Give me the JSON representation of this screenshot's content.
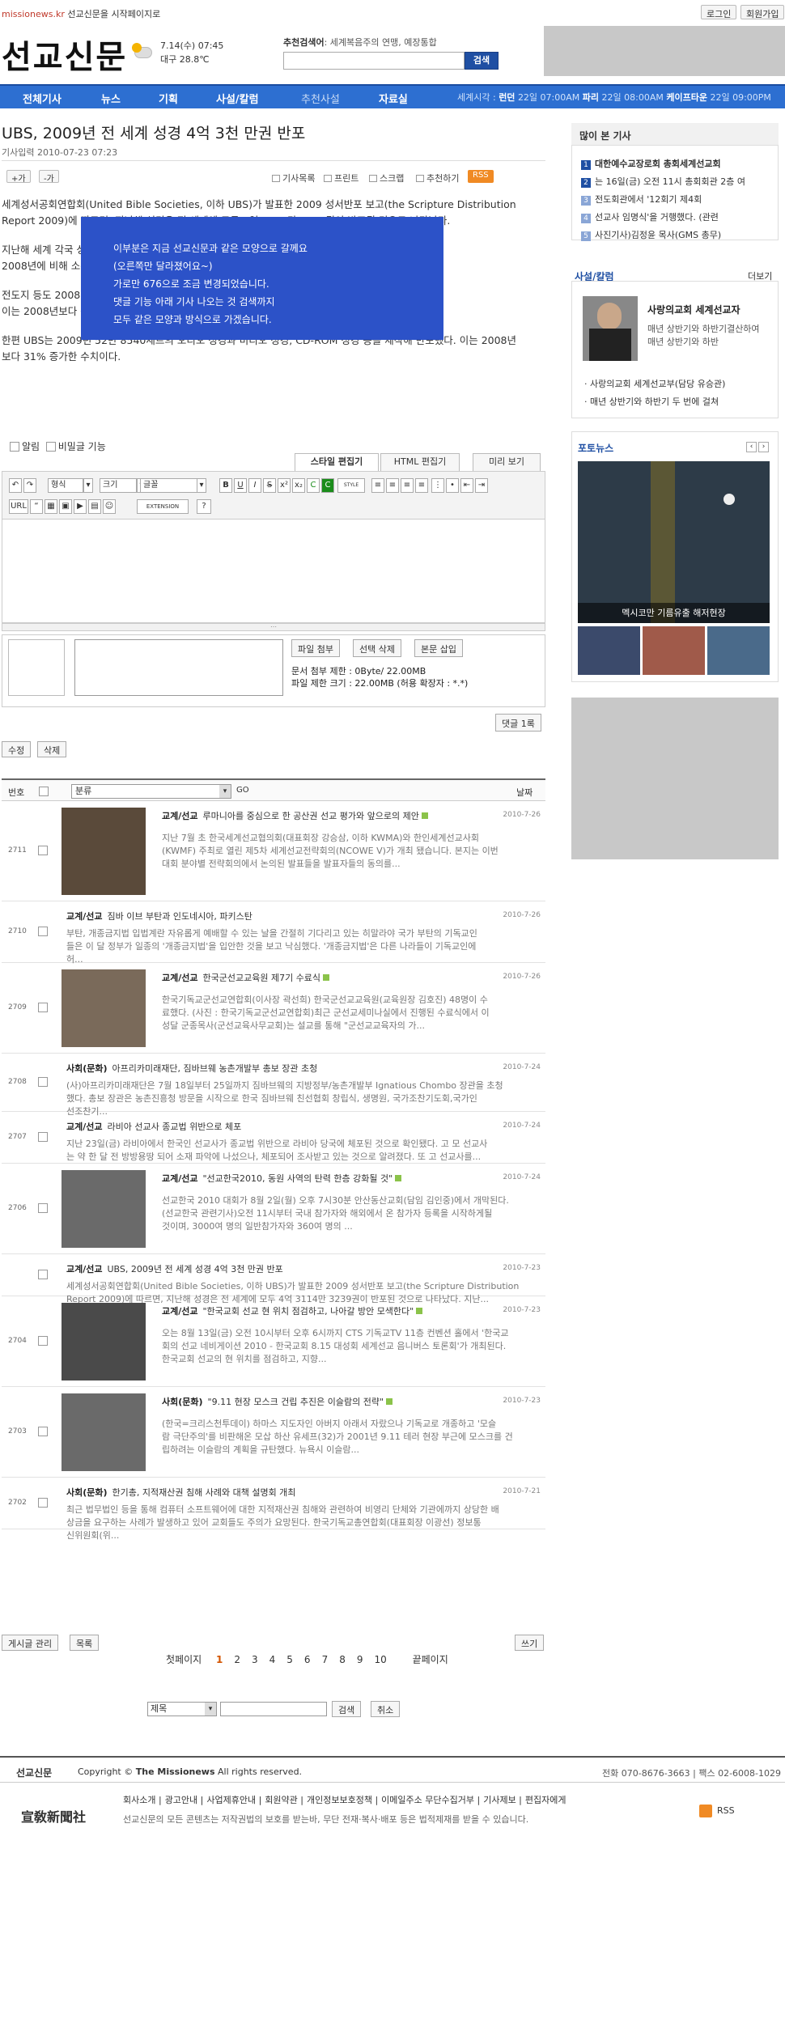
{
  "top": {
    "site": "missionews.kr",
    "set_home": "선교신문을 시작페이지로",
    "login": "로그인",
    "join": "회원가입"
  },
  "header": {
    "logo": "선교신문",
    "weather_date": "7.14(수) 07:45",
    "weather_temp": "대구 28.8℃",
    "rec_label": "추천검색어",
    "rec_terms": ": 세계복음주의 연맹, 예장통합",
    "search_button": "검색"
  },
  "nav": {
    "items": [
      "전체기사",
      "뉴스",
      "기획",
      "사설/칼럼",
      "추천사설",
      "자료실"
    ],
    "worldtime_label": "세계시각 :",
    "cities": [
      {
        "city": "런던",
        "time": "22일 07:00AM"
      },
      {
        "city": "파리",
        "time": "22일 08:00AM"
      },
      {
        "city": "케이프타운",
        "time": "22일 09:00PM"
      }
    ]
  },
  "article": {
    "title": "UBS, 2009년 전 세계 성경 4억 3천 만권 반포",
    "date_label": "기사입력",
    "date": "2010-07-23 07:23",
    "font_plus": "+가",
    "font_minus": "-가",
    "tools": [
      "기사목록",
      "프린트",
      "스크랩",
      "추천하기"
    ],
    "rss": "RSS",
    "paragraphs": [
      "세계성서공회연합회(United Bible Societies, 이하 UBS)가 발표한 2009 성서반포 보고(the Scripture Distribution",
      "Report 2009)에 따르면, 지난해 성경은 전 세계에 모두 4억 3114만 3239권이 반포된 것으로 나타났다.",
      "지난해 세계 각국 성서공회가 반포한 성경 중 신약성경과 구약성경을 포함한 전권 성경 등의 반포 부수는",
      "2008년에 비해 소폭 증가했으며, 특히 아시아 지역의 반포량이 크게 증가한 것으로 나타났다.",
      "전도지 등도 2008년에 비해 늘어났으며, 선택본 성경과 신약성경, 단편성경, 전도지는 6400만 부",
      "이는 2008년보다 증가한 수치로, 특히 전도지의 반포는 1억 부 이상 증가한 것으로 분석 중이다.",
      "한편 UBS는 2009년 52만 8540세트의 오디오 성경과 비디오 성경, CD-ROM 성경 등을 제작해 반포했다. 이는 2008년",
      "보다 31% 증가한 수치이다."
    ],
    "overlay": [
      "이부분은 지금 선교신문과 같은 모양으로 갈께요",
      "(오른쪽만 달라졌어요~)",
      "가로만 676으로 조금 변경되었습니다.",
      "댓글 기능 아래 기사 나오는 것 검색까지",
      "모두 같은 모양과 방식으로 가겠습니다."
    ]
  },
  "comment": {
    "alarm": "알림",
    "secret": "비밀글 기능",
    "tabs": [
      "스타일 편집기",
      "HTML 편집기",
      "미리 보기"
    ],
    "format": "형식",
    "size": "크기",
    "font": "글꼴",
    "upload_buttons": [
      "파일 첨부",
      "선택 삭제",
      "본문 삽입"
    ],
    "attach_limit": "문서 첨부 제한 : 0Byte/ 22.00MB",
    "file_limit": "파일 제한 크기 : 22.00MB (허용 확장자 : *.*)",
    "submit": "댓글 1록",
    "edit": "수정",
    "delete": "삭제"
  },
  "list": {
    "col_num": "번호",
    "col_cat": "분류",
    "go": "GO",
    "col_date": "날짜",
    "rows": [
      {
        "num": "2711",
        "cat": "교계/선교",
        "title": "루마니아를 중심으로 한 공산권 선교 평가와 앞으로의 제안",
        "date": "2010-7-26",
        "thumb": true,
        "desc": [
          "지난 7월 초 한국세계선교협의회(대표회장 강승삼, 이하 KWMA)와 한인세계선교사회",
          "(KWMF) 주최로 열린 제5차 세계선교전략회의(NCOWE V)가 개최 됐습니다. 본지는 이번",
          "대회 분야별 전략회의에서 논의된 발표들을 발표자들의 동의를..."
        ]
      },
      {
        "num": "2710",
        "cat": "교계/선교",
        "title": "짐바 이브 부탄과 인도네시아, 파키스탄",
        "date": "2010-7-26",
        "thumb": false,
        "desc": [
          "부탄, 개종금지법 입법계란 자유롭게 예배할 수 있는 날을 간절히 기다리고 있는 히말라야 국가 부탄의 기독교인",
          "들은 이 달 정부가 일종의 '개종금지법'을 입안한 것을 보고 낙심했다. '개종금지법'은 다른 나라들이 기독교인에",
          "허..."
        ]
      },
      {
        "num": "2709",
        "cat": "교계/선교",
        "title": "한국군선교교육원 제7기 수료식",
        "date": "2010-7-26",
        "thumb": true,
        "desc": [
          "한국기독교군선교연합회(이사장 곽선희) 한국군선교교육원(교육원장 김호진) 48명이 수",
          "료했다. (사진 : 한국기독교군선교연합회)최근 군선교세미나실에서 진행된 수료식에서 이",
          "성달 군종목사(군선교육사무교회)는 설교를 통해 \"군선교교육자의 가..."
        ]
      },
      {
        "num": "2708",
        "cat": "사회(문화)",
        "title": "아프리카미래재단, 짐바브웨 농촌개발부 총보 장관 초청",
        "date": "2010-7-24",
        "thumb": false,
        "desc": [
          "(사)아프리카미래재단은 7월 18일부터 25일까지 짐바브웨의 지방정부/농촌개발부 Ignatious Chombo 장관을 초청",
          "했다. 총보 장관은 농촌진흥청 방문을 시작으로 한국 짐바브웨 친선협회 창립식, 생명원, 국가조찬기도회,국가인",
          "선조찬기..."
        ]
      },
      {
        "num": "2707",
        "cat": "교계/선교",
        "title": "라비아 선교사 종교법 위반으로 체포",
        "date": "2010-7-24",
        "thumb": false,
        "desc": [
          "지난 23일(금) 라비아에서 한국인 선교사가 종교법 위반으로 라비아 당국에 체포된 것으로 확인됐다. 고 모 선교사",
          "는 약 한 달 전 방방용땅 되어 소재 파악에 나섰으나, 체포되어 조사받고 있는 것으로 알려졌다. 또 고 선교사를..."
        ]
      },
      {
        "num": "2706",
        "cat": "교계/선교",
        "title": "\"선교한국2010, 동원 사역의 탄력 한층 강화될 것\"",
        "date": "2010-7-24",
        "thumb": true,
        "desc": [
          "선교한국 2010 대회가 8월 2일(월) 오후 7시30분 안산동산교회(담임 김인중)에서 개막된다.",
          "(선교한국 관련기사)오전 11시부터 국내 참가자와 해외에서 온 참가자 등록을 시작하게될",
          "것이며, 3000여 명의 일반참가자와 360여 명의 ..."
        ]
      },
      {
        "num": "",
        "cat": "교계/선교",
        "title": "UBS, 2009년 전 세계 성경 4억 3천 만권 반포",
        "date": "2010-7-23",
        "thumb": false,
        "desc": [
          "세계성서공회연합회(United Bible Societies, 이하 UBS)가 발표한 2009 성서반포 보고(the Scripture Distribution",
          "Report 2009)에 따르면, 지난해 성경은 전 세계에 모두 4억 3114만 3239권이 반포된 것으로 나타났다. 지난..."
        ]
      },
      {
        "num": "2704",
        "cat": "교계/선교",
        "title": "\"한국교회 선교 현 위치 점검하고, 나아갈 방안 모색한다\"",
        "date": "2010-7-23",
        "thumb": true,
        "desc": [
          "오는 8월 13일(금) 오전 10시부터 오후 6시까지 CTS 기독교TV 11층 컨벤션 홀에서 '한국교",
          "회의 선교 네비게이션 2010 - 한국교회 8.15 대성회 세계선교 음니버스 토론회'가 개최된다.",
          "한국교회 선교의 현 위치를 점검하고, 지향..."
        ]
      },
      {
        "num": "2703",
        "cat": "사회(문화)",
        "title": "\"9.11 현장 모스크 건립 추진은 이슬람의 전략\"",
        "date": "2010-7-23",
        "thumb": true,
        "desc": [
          "(한국=크리스천투데이) 하마스 지도자인 아버지 아래서 자랐으나 기독교로 개종하고 '모슬",
          "람 극단주의'를 비판해온 모삽 하산 유세프(32)가 2001년 9.11 테러 현장 부근에 모스크를 건",
          "립하려는 이슬람의 계획을 규탄했다. 뉴욕시 이슬람..."
        ]
      },
      {
        "num": "2702",
        "cat": "사회(문화)",
        "title": "한기총, 지적재산권 침해 사례와 대책 설명회 개최",
        "date": "2010-7-21",
        "thumb": false,
        "desc": [
          "최근 법무법인 등을 통해 컴퓨터 소프트웨어에 대한 지적재산권 침해와 관련하여 비영리 단체와 기관에까지 상당한 배",
          "상금을 요구하는 사례가 발생하고 있어 교회들도 주의가 요망된다. 한국기독교총연합회(대표회장 이광선) 정보통",
          "신위원회(위..."
        ]
      }
    ],
    "admin": "게시글 관리",
    "list_btn": "목록",
    "write": "쓰기",
    "first": "첫페이지",
    "pages": [
      "1",
      "2",
      "3",
      "4",
      "5",
      "6",
      "7",
      "8",
      "9",
      "10"
    ],
    "last": "끝페이지",
    "search_field": "제목",
    "search_btn": "검색",
    "cancel_btn": "취소"
  },
  "sidebar": {
    "popular_title": "많이 본 기사",
    "popular": [
      "대한예수교장로회 총회세계선교회",
      "는 16일(금) 오전 11시 총회회관 2층 여",
      "전도회관에서 '12회기 제4회",
      "선교사 임명식'을 거행했다. (관련",
      "사진기사)김정윤 목사(GMS 총무)"
    ],
    "opinion_title": "사설/칼럼",
    "more": "더보기",
    "opinion_head": "사랑의교회 세계선교자",
    "opinion_lines": [
      "매년 상반기와 하반기결산하여",
      "매년 상반기와 하반"
    ],
    "opinion_list": [
      "사랑의교회 세계선교부(담당 유승관)",
      "매년 상반기와 하반기 두 번에 걸쳐"
    ],
    "photo_title": "포토뉴스",
    "photo_caption": "멕시코만 기름유출 해저현장"
  },
  "footer": {
    "logo": "선교신문",
    "copyright_pre": "Copyright ©",
    "copyright_brand": "The Missionews",
    "copyright_post": "All rights reserved.",
    "phone": "전화 070-8676-3663 | 팩스 02-6008-1029",
    "hanja_logo": "宣敎新聞社",
    "links": [
      "회사소개",
      "광고안내",
      "사업제휴안내",
      "회원약관",
      "개인정보보호정책",
      "이메일주소 무단수집거부",
      "기사제보",
      "편집자에게"
    ],
    "rss": "RSS",
    "notice": "선교신문의 모든 콘텐츠는 저작권법의 보호를 받는바, 무단 전재·복사·배포 등은 법적제재를 받을 수 있습니다."
  },
  "colors": {
    "nav": "#2d6fd1",
    "overlay": "#2c52c8",
    "brand_red": "#c0392b",
    "rss": "#f08a24"
  }
}
